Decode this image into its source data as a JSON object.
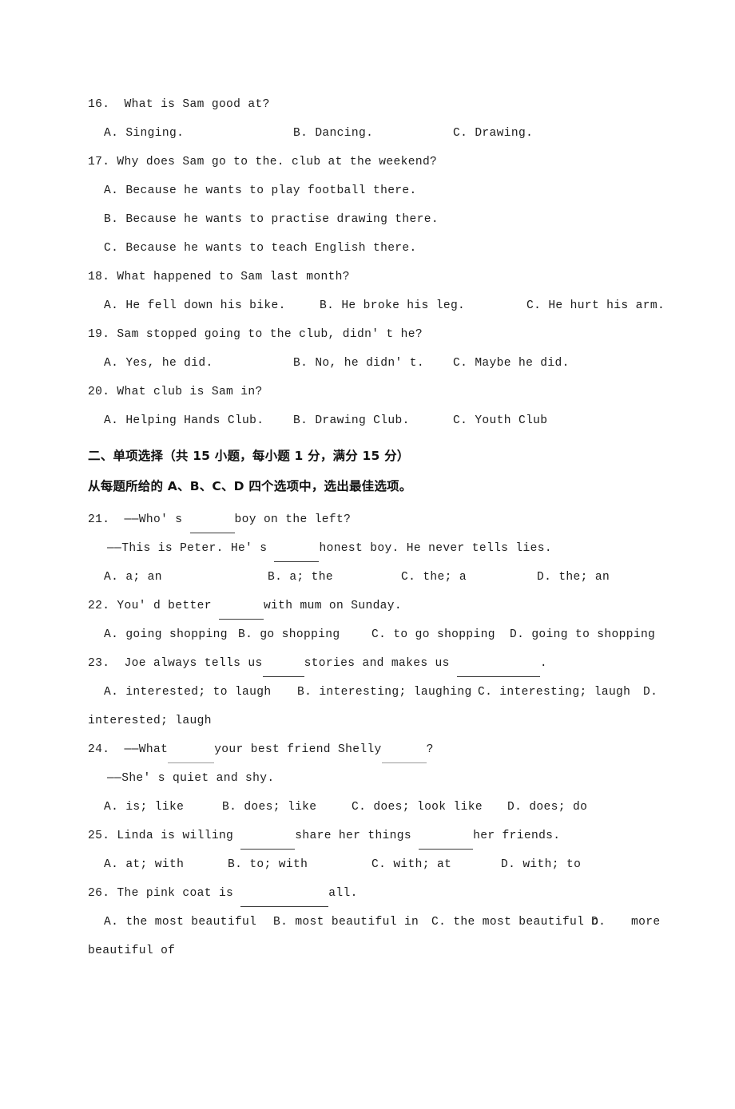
{
  "document": {
    "type": "english-exam-paper",
    "background_color": "#ffffff",
    "text_color": "#1d1d1d"
  },
  "listening_section": {
    "questions": [
      {
        "number": "16.",
        "stem": "16.  What is Sam good at?",
        "options": [
          "A. Singing.",
          "B. Dancing.",
          "C. Drawing."
        ]
      },
      {
        "number": "17.",
        "stem": "17. Why does Sam go to the. club at the weekend?",
        "stacked_options": [
          "A. Because he wants to play football there.",
          "B. Because he wants to practise drawing there.",
          "C. Because he wants to teach English there."
        ]
      },
      {
        "number": "18.",
        "stem": "18. What happened to Sam last month?",
        "options": [
          "A. He fell down his bike.",
          "B. He broke his leg.",
          "C. He hurt his arm."
        ]
      },
      {
        "number": "19.",
        "stem": "19. Sam stopped going to the club, didn' t he?",
        "options": [
          "A. Yes, he did.",
          "B. No, he didn' t.",
          "C. Maybe he did."
        ]
      },
      {
        "number": "20.",
        "stem": "20. What club is Sam in?",
        "options": [
          "A. Helping Hands Club.",
          "B. Drawing Club.",
          "C. Youth Club"
        ]
      }
    ]
  },
  "section_two": {
    "heading": "二、单项选择（共 15 小题，每小题 1 分，满分 15 分）",
    "instruction": "从每题所给的 A、B、C、D 四个选项中，选出最佳选项。"
  },
  "multiple_choice": {
    "questions": [
      {
        "number": "21.",
        "stem_line_1_before": "21.  ——Who' s ",
        "stem_line_1_after": "boy on the left?",
        "stem_line_2_before": "——This is Peter. He' s ",
        "stem_line_2_after": "honest boy. He never tells lies.",
        "options": [
          "A. a; an",
          "B. a; the",
          "C. the; a",
          "D. the; an"
        ]
      },
      {
        "number": "22.",
        "stem_before": "22. You' d better ",
        "stem_after": "with mum on Sunday.",
        "options": [
          "A. going shopping",
          "B. go shopping",
          "C. to go shopping",
          "D. going to shopping"
        ]
      },
      {
        "number": "23.",
        "stem_part_1": "23.  Joe always tells us",
        "stem_part_2": "stories and makes us ",
        "stem_part_3": ".",
        "options": [
          "A. interested; to laugh",
          "B. interesting; laughing",
          "C. interesting; laugh",
          "D."
        ],
        "wrapped_option_tail": "interested; laugh"
      },
      {
        "number": "24.",
        "stem_line_1_part_1": "24.  ——What",
        "stem_line_1_part_2": "your best friend Shelly",
        "stem_line_1_part_3": "?",
        "stem_line_2": "——She' s quiet and shy.",
        "options": [
          "A. is; like",
          "B. does; like",
          "C. does; look like",
          "D. does; do"
        ]
      },
      {
        "number": "25.",
        "stem_part_1": "25. Linda is willing ",
        "stem_part_2": "share her things ",
        "stem_part_3": "her friends.",
        "options": [
          "A. at; with",
          "B. to; with",
          "C. with; at",
          "D. with; to"
        ]
      },
      {
        "number": "26.",
        "stem_part_1": "26. The pink coat is ",
        "stem_part_2": "all.",
        "options": [
          "A. the most beautiful",
          "B. most beautiful in",
          "C. the most beautiful o",
          "D.",
          "more"
        ],
        "wrapped_option_tail": "beautiful of"
      }
    ]
  }
}
